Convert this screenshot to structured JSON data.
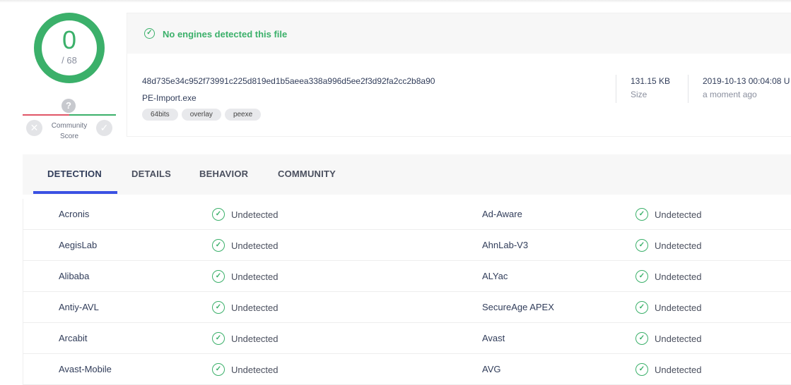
{
  "score": {
    "detections": "0",
    "total": "/ 68"
  },
  "community": {
    "question": "?",
    "label_line1": "Community",
    "label_line2": "Score",
    "vote_bad": "✕",
    "vote_good": "✓"
  },
  "summary": {
    "banner_icon": "check-circle-icon",
    "banner_text": "No engines detected this file",
    "hash": "48d735e34c952f73991c225d819ed1b5aeea338a996d5ee2f3d92fa2cc2b8a90",
    "filename": "PE-Import.exe",
    "tags": [
      "64bits",
      "overlay",
      "peexe"
    ],
    "size_value": "131.15 KB",
    "size_label": "Size",
    "date_value": "2019-10-13 00:04:08 U",
    "date_label": "a moment ago"
  },
  "tabs": [
    "DETECTION",
    "DETAILS",
    "BEHAVIOR",
    "COMMUNITY"
  ],
  "active_tab": "DETECTION",
  "detections": [
    {
      "left": {
        "engine": "Acronis",
        "result": "Undetected"
      },
      "right": {
        "engine": "Ad-Aware",
        "result": "Undetected"
      }
    },
    {
      "left": {
        "engine": "AegisLab",
        "result": "Undetected"
      },
      "right": {
        "engine": "AhnLab-V3",
        "result": "Undetected"
      }
    },
    {
      "left": {
        "engine": "Alibaba",
        "result": "Undetected"
      },
      "right": {
        "engine": "ALYac",
        "result": "Undetected"
      }
    },
    {
      "left": {
        "engine": "Antiy-AVL",
        "result": "Undetected"
      },
      "right": {
        "engine": "SecureAge APEX",
        "result": "Undetected"
      }
    },
    {
      "left": {
        "engine": "Arcabit",
        "result": "Undetected"
      },
      "right": {
        "engine": "Avast",
        "result": "Undetected"
      }
    },
    {
      "left": {
        "engine": "Avast-Mobile",
        "result": "Undetected"
      },
      "right": {
        "engine": "AVG",
        "result": "Undetected"
      }
    }
  ],
  "colors": {
    "clean": "#3bb06a",
    "malicious": "#e05567",
    "accent": "#3b51e3"
  }
}
